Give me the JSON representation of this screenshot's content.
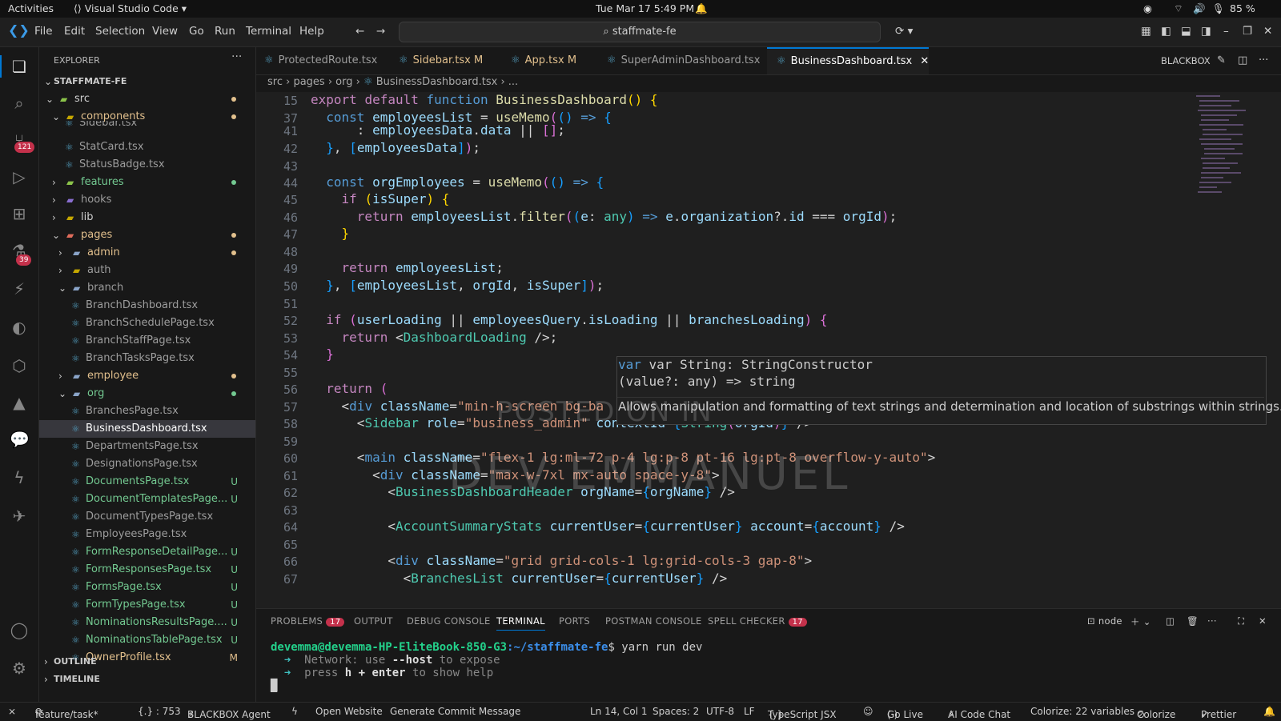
{
  "system": {
    "activities": "Activities",
    "app_name": "Visual Studio Code",
    "clock": "Tue Mar 17  5:49 PM",
    "battery": "85 %"
  },
  "menu": {
    "file": "File",
    "edit": "Edit",
    "selection": "Selection",
    "view": "View",
    "go": "Go",
    "run": "Run",
    "terminal": "Terminal",
    "help": "Help"
  },
  "search": {
    "value": "staffmate-fe"
  },
  "activity": {
    "scm_badge": "121",
    "extensions_badge": "39"
  },
  "explorer": {
    "title": "EXPLORER",
    "root": "STAFFMATE-FE",
    "items": [
      {
        "label": "src"
      },
      {
        "label": "components"
      },
      {
        "label": "Sidebar.tsx"
      },
      {
        "label": "StatCard.tsx"
      },
      {
        "label": "StatusBadge.tsx"
      },
      {
        "label": "features"
      },
      {
        "label": "hooks"
      },
      {
        "label": "lib"
      },
      {
        "label": "pages"
      },
      {
        "label": "admin"
      },
      {
        "label": "auth"
      },
      {
        "label": "branch"
      },
      {
        "label": "BranchDashboard.tsx"
      },
      {
        "label": "BranchSchedulePage.tsx"
      },
      {
        "label": "BranchStaffPage.tsx"
      },
      {
        "label": "BranchTasksPage.tsx"
      },
      {
        "label": "employee"
      },
      {
        "label": "org"
      },
      {
        "label": "BranchesPage.tsx"
      },
      {
        "label": "BusinessDashboard.tsx"
      },
      {
        "label": "DepartmentsPage.tsx"
      },
      {
        "label": "DesignationsPage.tsx"
      },
      {
        "label": "DocumentsPage.tsx",
        "status": "U"
      },
      {
        "label": "DocumentTemplatesPage...",
        "status": "U"
      },
      {
        "label": "DocumentTypesPage.tsx"
      },
      {
        "label": "EmployeesPage.tsx"
      },
      {
        "label": "FormResponseDetailPage...",
        "status": "U"
      },
      {
        "label": "FormResponsesPage.tsx",
        "status": "U"
      },
      {
        "label": "FormsPage.tsx",
        "status": "U"
      },
      {
        "label": "FormTypesPage.tsx",
        "status": "U"
      },
      {
        "label": "NominationsResultsPage....",
        "status": "U"
      },
      {
        "label": "NominationsTablePage.tsx",
        "status": "U"
      },
      {
        "label": "OwnerProfile.tsx",
        "status": "M"
      }
    ],
    "outline": "OUTLINE",
    "timeline": "TIMELINE"
  },
  "tabs": [
    {
      "label": "ProtectedRoute.tsx",
      "mod": ""
    },
    {
      "label": "Sidebar.tsx",
      "mod": "M"
    },
    {
      "label": "App.tsx",
      "mod": "M"
    },
    {
      "label": "SuperAdminDashboard.tsx",
      "mod": ""
    },
    {
      "label": "BusinessDashboard.tsx",
      "mod": ""
    }
  ],
  "blackbox": "BLACKBOX",
  "breadcrumb": {
    "p1": "src",
    "p2": "pages",
    "p3": "org",
    "p4": "BusinessDashboard.tsx",
    "p5": "..."
  },
  "line_numbers": [
    "15",
    "37",
    "41",
    "42",
    "43",
    "44",
    "45",
    "46",
    "47",
    "48",
    "49",
    "50",
    "51",
    "52",
    "53",
    "54",
    "55",
    "56",
    "57",
    "58",
    "59",
    "60",
    "61",
    "62",
    "63",
    "64",
    "65",
    "66",
    "67"
  ],
  "hover": {
    "sig1": "var String: StringConstructor",
    "sig2": "(value?: any) => string",
    "doc": "Allows manipulation and formatting of text strings and determination and location of substrings within strings."
  },
  "watermark": {
    "line1": "POSTED ON IN",
    "line2": "DEV EMMANUEL"
  },
  "panel": {
    "problems": "PROBLEMS",
    "problems_count": "17",
    "output": "OUTPUT",
    "debug": "DEBUG CONSOLE",
    "terminal": "TERMINAL",
    "ports": "PORTS",
    "postman": "POSTMAN CONSOLE",
    "spell": "SPELL CHECKER",
    "spell_count": "17",
    "shell": "node"
  },
  "terminal": {
    "prompt_user": "devemma@devemma-HP-EliteBook-850-G3",
    "prompt_path": ":~/staffmate-fe",
    "command": "$ yarn run dev",
    "line1_label": "Network",
    "line1_rest": ": use ",
    "line1_flag": "--host",
    "line1_end": " to expose",
    "line2_a": "press ",
    "line2_key": "h + enter",
    "line2_end": " to show help"
  },
  "status": {
    "branch": "feature/task*",
    "symbols": "{.} : 753",
    "blackbox_agent": "BLACKBOX Agent",
    "open_website": "Open Website",
    "commit_msg": "Generate Commit Message",
    "position": "Ln 14, Col 1",
    "spaces": "Spaces: 2",
    "encoding": "UTF-8",
    "eol": "LF",
    "language": "TypeScript JSX",
    "go_live": "Go Live",
    "ai_chat": "AI Code Chat",
    "colorize_vars": "Colorize: 22 variables",
    "colorize": "Colorize",
    "prettier": "Prettier"
  },
  "colors": {
    "accent": "#0078d4",
    "modified": "#e2c08d",
    "untracked": "#73c991",
    "badge": "#c4314b"
  }
}
